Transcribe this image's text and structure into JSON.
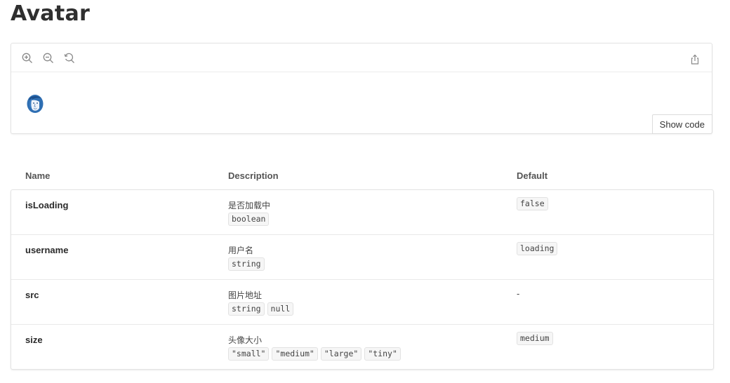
{
  "page": {
    "title": "Avatar"
  },
  "preview": {
    "tools": [
      "zoom-in-icon",
      "zoom-out-icon",
      "reset-zoom-icon"
    ],
    "share_icon": "share-icon",
    "show_code_label": "Show code"
  },
  "props_table": {
    "headers": {
      "name": "Name",
      "description": "Description",
      "default": "Default"
    },
    "rows": [
      {
        "name": "isLoading",
        "description": "是否加载中",
        "types": [
          "boolean"
        ],
        "default": "false",
        "default_is_code": true
      },
      {
        "name": "username",
        "description": "用户名",
        "types": [
          "string"
        ],
        "default": "loading",
        "default_is_code": true
      },
      {
        "name": "src",
        "description": "图片地址",
        "types": [
          "string",
          "null"
        ],
        "default": "-",
        "default_is_code": false
      },
      {
        "name": "size",
        "description": "头像大小",
        "types": [
          "\"small\"",
          "\"medium\"",
          "\"large\"",
          "\"tiny\""
        ],
        "default": "medium",
        "default_is_code": true
      }
    ]
  }
}
